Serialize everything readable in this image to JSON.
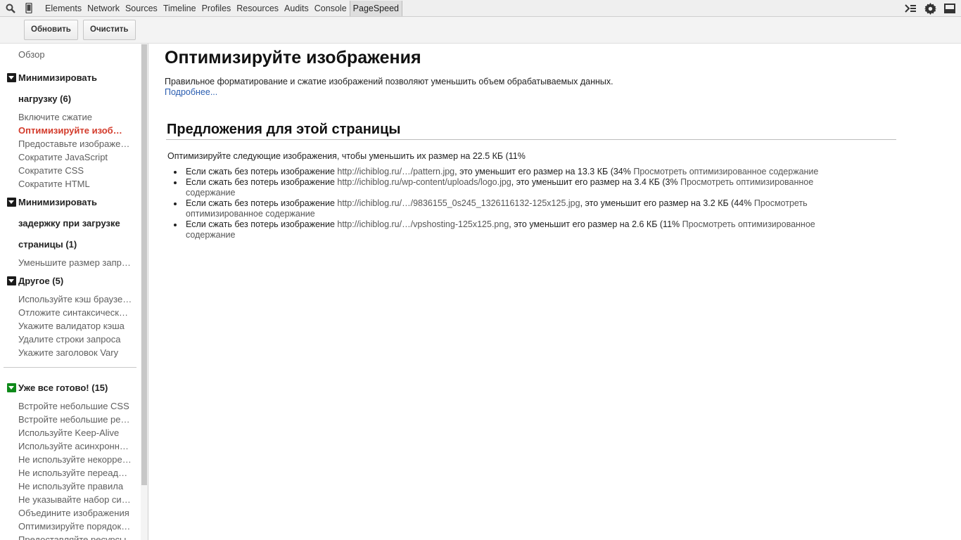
{
  "toolbar": {
    "search_icon": "search-icon",
    "device_icon": "device-mode-icon",
    "tabs": [
      "Elements",
      "Network",
      "Sources",
      "Timeline",
      "Profiles",
      "Resources",
      "Audits",
      "Console",
      "PageSpeed"
    ],
    "active_tab": "PageSpeed"
  },
  "actions": {
    "refresh": "Обновить",
    "clear": "Очистить"
  },
  "sidebar": {
    "overview": "Обзор",
    "group1": {
      "title_line1": "Минимизировать",
      "title_line2": "нагрузку (6)",
      "items": [
        "Включите сжатие",
        "Оптимизируйте изображения",
        "Предоставьте изображения нужного размера",
        "Сократите JavaScript",
        "Сократите CSS",
        "Сократите HTML"
      ]
    },
    "group2": {
      "title_line1": "Минимизировать",
      "title_line2": "задержку при загрузке",
      "title_line3": "страницы (1)",
      "items": [
        "Уменьшите размер запроса"
      ]
    },
    "group3": {
      "title": "Другое (5)",
      "items": [
        "Используйте кэш браузера",
        "Отложите синтаксический анализ",
        "Укажите валидатор кэша",
        "Удалите строки запроса",
        "Укажите заголовок Vary"
      ]
    },
    "group4": {
      "title": "Уже все готово! (15)",
      "items": [
        "Встройте небольшие CSS",
        "Встройте небольшие ресурсы",
        "Используйте Keep-Alive",
        "Используйте асинхронные скрипты",
        "Не используйте некорректные запросы",
        "Не используйте переадресацию",
        "Не используйте правила",
        "Не указывайте набор символов",
        "Объедините изображения",
        "Оптимизируйте порядок стилей",
        "Предоставляйте ресурсы"
      ]
    }
  },
  "main": {
    "title": "Оптимизируйте изображения",
    "description": "Правильное форматирование и сжатие изображений позволяют уменьшить объем обрабатываемых данных.",
    "more_link": "Подробнее...",
    "suggestions_title": "Предложения для этой страницы",
    "intro": "Оптимизируйте следующие изображения, чтобы уменьшить их размер на 22.5 КБ (11%",
    "suggestions": [
      {
        "prefix": "Если сжать без потерь изображение ",
        "url": "http://ichiblog.ru/…/pattern.jpg",
        "middle": ", это уменьшит его размер на 13.3 КБ (34% ",
        "link": "Просмотреть оптимизированное содержание"
      },
      {
        "prefix": "Если сжать без потерь изображение ",
        "url": "http://ichiblog.ru/wp-content/uploads/logo.jpg",
        "middle": ", это уменьшит его размер на 3.4 КБ (3% ",
        "link": "Просмотреть оптимизированное содержание"
      },
      {
        "prefix": "Если сжать без потерь изображение ",
        "url": "http://ichiblog.ru/…/9836155_0s245_1326116132-125x125.jpg",
        "middle": ", это уменьшит его размер на 3.2 КБ (44% ",
        "link": "Просмотреть оптимизированное содержание"
      },
      {
        "prefix": "Если сжать без потерь изображение ",
        "url": "http://ichiblog.ru/…/vpshosting-125x125.png",
        "middle": ", это уменьшит его размер на 2.6 КБ (11% ",
        "link": "Просмотреть оптимизированное содержание"
      }
    ]
  }
}
